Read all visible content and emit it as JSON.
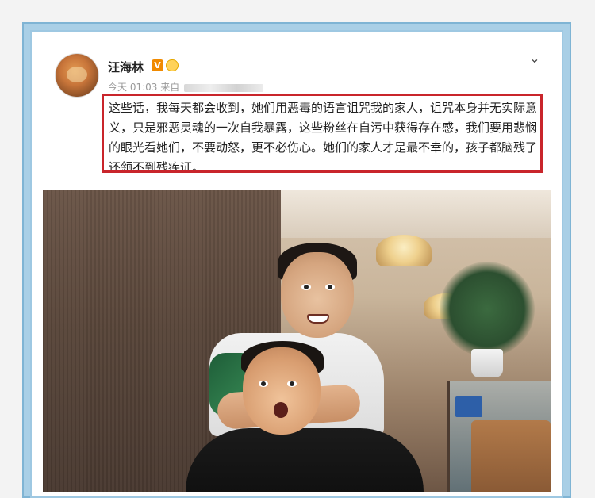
{
  "post": {
    "author": {
      "name": "汪海林",
      "verified_badge": "V",
      "vip_badge": "vip-icon"
    },
    "meta": {
      "time": "今天 01:03",
      "source_prefix": "来自"
    },
    "content": "这些话，我每天都会收到，她们用恶毒的语言诅咒我的家人，诅咒本身并无实际意义，只是邪恶灵魂的一次自我暴露，这些粉丝在自污中获得存在感，我们要用悲悯的眼光看她们，不要动怒，更不必伤心。她们的家人才是最不幸的，孩子都脑残了还领不到残疾证。",
    "menu_icon": "chevron-down-icon"
  },
  "colors": {
    "highlight_border": "#c9252b",
    "frame_blue": "#a9cfe6",
    "verified_orange": "#f08a00"
  }
}
